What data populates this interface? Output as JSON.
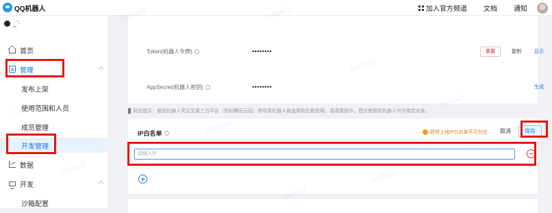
{
  "topbar": {
    "app_name": "QQ机器人",
    "links": [
      "加入官方频道",
      "文档",
      "通知"
    ]
  },
  "sidebar": {
    "user_name": "_ˇ·",
    "home": "首页",
    "manage": "管理",
    "manage_items": [
      "发布上架",
      "使用范围和人员",
      "成员管理",
      "开发管理"
    ],
    "data": "数据",
    "develop": "开发",
    "develop_items": [
      "沙箱配置"
    ]
  },
  "credentials": {
    "token_label": "Token(机器人令牌)",
    "token_value": "••••••••",
    "reset": "重置",
    "copy": "复制",
    "show": "显示",
    "secret_label": "AppSecret(机器人密钥)",
    "secret_value": "••••••••",
    "generate": "生成"
  },
  "risk_notice": "风险提示：按钮机器人凭证至第三方平台（例如腾讯云函）将导致机器人被盗用和拦截管理，请谨慎操作，建议使用新机器人作为绑定对象。",
  "ip_whitelist": {
    "title": "IP白名单",
    "warning": "即将上线IP白名单不可为空",
    "cancel": "取消",
    "save": "保存",
    "input_placeholder": "请输入IP"
  },
  "watermark": "contact",
  "colors": {
    "accent": "#1a73e8",
    "highlight": "#e5140b",
    "danger": "#e03030",
    "warning": "#f59c1a"
  }
}
